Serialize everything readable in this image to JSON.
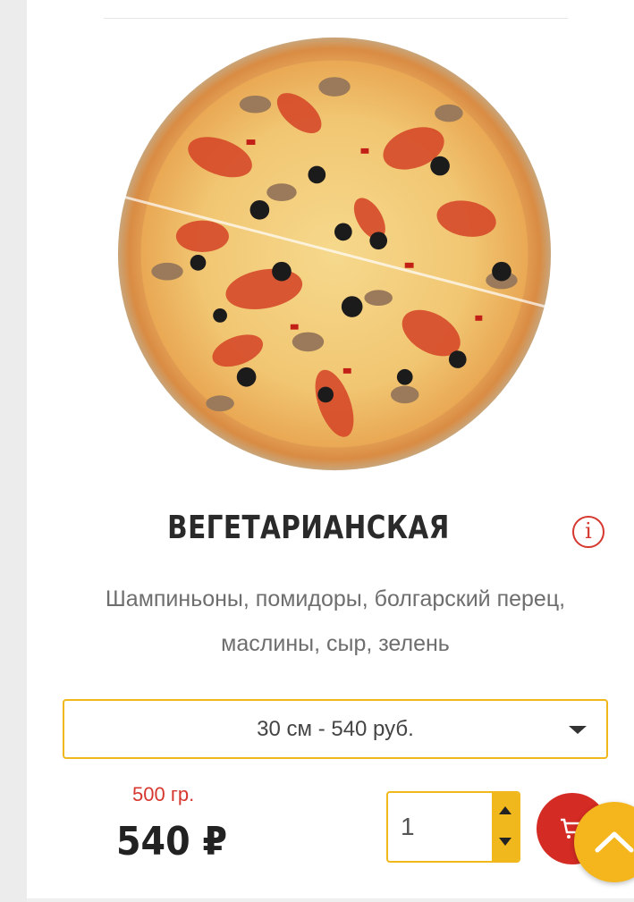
{
  "product": {
    "title": "ВЕГЕТАРИАНСКАЯ",
    "description": "Шампиньоны, помидоры, болгарский перец, маслины, сыр, зелень",
    "size_select": {
      "selected": "30 см - 540 руб."
    },
    "weight": "500 гр.",
    "price": "540 ₽",
    "quantity": "1"
  },
  "icons": {
    "info": "info-icon",
    "cart": "cart-icon",
    "scroll_top": "chevron-up-icon",
    "caret": "chevron-down-icon"
  },
  "colors": {
    "accent_yellow": "#f0b81c",
    "accent_red": "#d42b24",
    "title": "#2a2a2a",
    "description": "#6e6e6e"
  }
}
